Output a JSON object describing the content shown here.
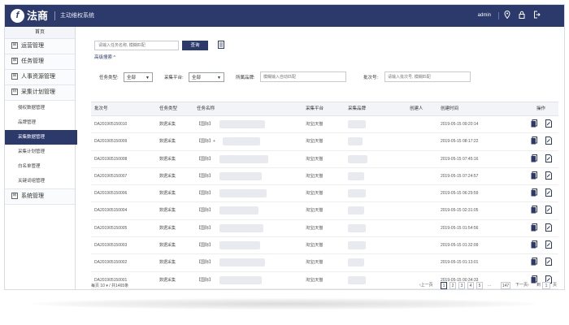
{
  "header": {
    "logo_mark": "f",
    "logo_text": "法商",
    "system_title": "主动维权系统",
    "user": "admin",
    "icons": [
      "location-icon",
      "lock-icon",
      "logout-icon"
    ]
  },
  "sidebar": {
    "home": "首页",
    "groups": [
      {
        "label": "运营管理",
        "marker": "⊞"
      },
      {
        "label": "任务管理",
        "marker": "⊞"
      },
      {
        "label": "人事资源管理",
        "marker": "⊞"
      },
      {
        "label": "采集计划管理",
        "marker": "⊟"
      }
    ],
    "sub_items": [
      "侵权数据管理",
      "品牌管理",
      "采集数据管理",
      "采集计划管理",
      "白名单管理",
      "关键词组管理"
    ],
    "active_sub": 2,
    "last_group": {
      "label": "系统管理",
      "marker": "⊞"
    }
  },
  "search": {
    "placeholder": "请输入任务名称, 模糊匹配",
    "query_label": "查询",
    "advanced_label": "高级搜索 ^"
  },
  "filters": {
    "task_type_label": "任务类型:",
    "task_type_value": "全部",
    "platform_label": "采集平台:",
    "platform_value": "全部",
    "brand_label": "所属品牌:",
    "brand_placeholder": "模糊输入自动匹配",
    "batch_label": "批次号:",
    "batch_placeholder": "请输入批次号, 模糊匹配"
  },
  "table": {
    "columns": [
      "批次号",
      "任务类型",
      "任务名称",
      "采集平台",
      "采集品牌",
      "创建人",
      "创建时间",
      "操作"
    ],
    "rows": [
      {
        "batch": "DA201905150010",
        "type": "数据采集",
        "name": "【国际】",
        "platform": "淘宝|天猫",
        "time": "2019-05-15 09:20:14"
      },
      {
        "batch": "DA201905150009",
        "type": "数据采集",
        "name": "【国际】+",
        "platform": "淘宝|天猫",
        "time": "2019-05-15 08:17:22"
      },
      {
        "batch": "DA201905150008",
        "type": "数据采集",
        "name": "【国际】",
        "platform": "淘宝|天猫",
        "time": "2019-05-15 07:45:16"
      },
      {
        "batch": "DA201905150007",
        "type": "数据采集",
        "name": "【国际】",
        "platform": "淘宝|天猫",
        "time": "2019-05-15 07:24:57"
      },
      {
        "batch": "DA201905150006",
        "type": "数据采集",
        "name": "【国际】",
        "platform": "淘宝|天猫",
        "time": "2019-05-15 06:29:59"
      },
      {
        "batch": "DA201905150004",
        "type": "数据采集",
        "name": "【国际】",
        "platform": "淘宝|天猫",
        "time": "2019-05-15 02:31:05"
      },
      {
        "batch": "DA201905150005",
        "type": "数据采集",
        "name": "【国际】",
        "platform": "淘宝|天猫",
        "time": "2019-05-15 01:54:56"
      },
      {
        "batch": "DA201905150003",
        "type": "数据采集",
        "name": "【国际】",
        "platform": "淘宝|天猫",
        "time": "2019-05-15 01:32:09"
      },
      {
        "batch": "DA201905150002",
        "type": "数据采集",
        "name": "【国际】",
        "platform": "淘宝|天猫",
        "time": "2019-05-15 01:13:01"
      },
      {
        "batch": "DA201905150001",
        "type": "数据采集",
        "name": "【国际】",
        "platform": "淘宝|天猫",
        "time": "2019-05-15 00:34:33"
      }
    ],
    "op_icons": [
      "view-icon",
      "edit-icon"
    ]
  },
  "pagination": {
    "page_size_text": "每页 10 ▾ / 共1465条",
    "prev": "‹上一页",
    "pages": [
      "1",
      "2",
      "3",
      "4",
      "5"
    ],
    "ellipsis": "...",
    "last": "147",
    "next": "下一页›",
    "goto_prefix": "到",
    "goto_value": "1",
    "goto_suffix": "页"
  }
}
